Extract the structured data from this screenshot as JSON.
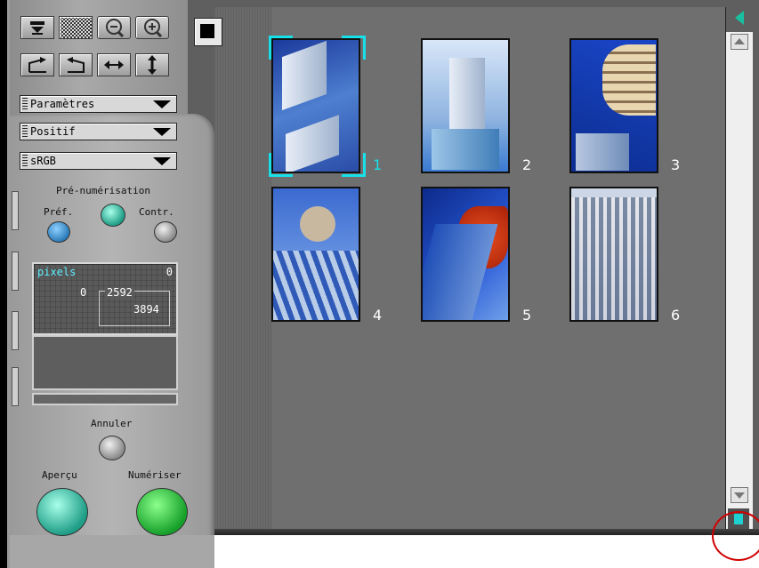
{
  "toolbar": {
    "row1": [
      "eject-icon",
      "pattern-icon",
      "zoom-out-icon",
      "zoom-in-icon"
    ],
    "row2": [
      "rotate-right-icon",
      "rotate-left-icon",
      "flip-horizontal-icon",
      "flip-vertical-icon"
    ]
  },
  "dropdowns": {
    "settings": "Paramètres",
    "film_type": "Positif",
    "color_space": "sRGB"
  },
  "prescan": {
    "title": "Pré-numérisation",
    "pref_label": "Préf.",
    "contr_label": "Contr."
  },
  "info": {
    "unit": "pixels",
    "top_value": "0",
    "left_value": "0",
    "width": "2592",
    "height": "3894"
  },
  "buttons": {
    "cancel": "Annuler",
    "preview": "Aperçu",
    "scan": "Numériser"
  },
  "thumbnails": [
    {
      "number": "1",
      "selected": true
    },
    {
      "number": "2",
      "selected": false
    },
    {
      "number": "3",
      "selected": false
    },
    {
      "number": "4",
      "selected": false
    },
    {
      "number": "5",
      "selected": false
    },
    {
      "number": "6",
      "selected": false
    }
  ],
  "colors": {
    "selection": "#18e0e8",
    "highlight_circle": "#d00000"
  }
}
